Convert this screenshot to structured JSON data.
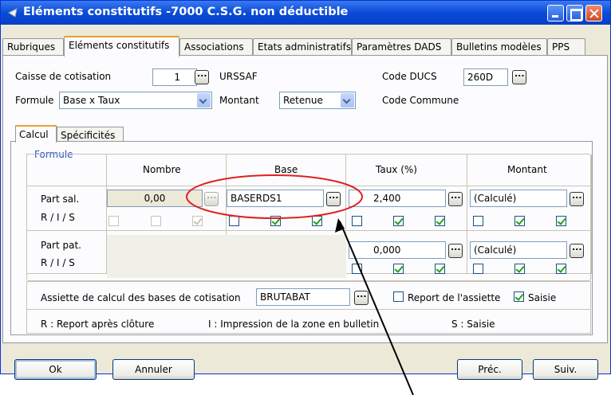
{
  "window": {
    "title": "Eléments constitutifs -7000 C.S.G. non déductible"
  },
  "tabs": [
    "Rubriques",
    "Eléments constitutifs",
    "Associations",
    "Etats administratifs",
    "Paramètres DADS",
    "Bulletins modèles",
    "PPS"
  ],
  "header": {
    "caisse_label": "Caisse de cotisation",
    "caisse_value": "1",
    "caisse_name": "URSSAF",
    "code_ducs_label": "Code DUCS",
    "code_ducs_value": "260D",
    "formule_label": "Formule",
    "formule_value": "Base x Taux",
    "montant_label": "Montant",
    "montant_value": "Retenue",
    "code_commune_label": "Code Commune"
  },
  "inner_tabs": [
    "Calcul",
    "Spécificités"
  ],
  "formule": {
    "caption": "Formule",
    "columns": [
      "Nombre",
      "Base",
      "Taux (%)",
      "Montant"
    ],
    "part_sal_label": "Part sal.",
    "ris_label": "R / I / S",
    "part_pat_label": "Part pat.",
    "sal": {
      "nombre": "0,00",
      "base": "BASERDS1",
      "taux": "2,400",
      "montant": "(Calculé)"
    },
    "pat": {
      "taux": "0,000",
      "montant": "(Calculé)"
    }
  },
  "assiette": {
    "label": "Assiette de calcul des bases de cotisation",
    "value": "BRUTABAT",
    "report_label": "Report de l'assiette",
    "saisie_label": "Saisie"
  },
  "legend": {
    "r": "R : Report après clôture",
    "i": "I : Impression de la zone en bulletin",
    "s": "S : Saisie"
  },
  "buttons": {
    "ok": "Ok",
    "annuler": "Annuler",
    "prec": "Préc.",
    "suiv": "Suiv."
  },
  "colors": {
    "title_bar": "#0a4ad8",
    "annotation": "#e02020",
    "group_caption": "#2050c8"
  }
}
